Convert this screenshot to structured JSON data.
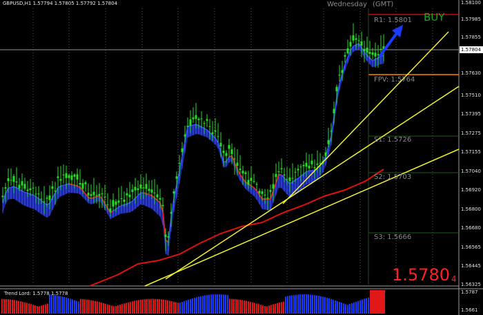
{
  "header": {
    "symbol_info": "GBPUSD,H1  1.57794 1.57805 1.57792 1.57804",
    "day": "Wednesday",
    "timezone": "(GMT)",
    "signal": "BUY"
  },
  "levels": {
    "r1": "R1: 1.5801",
    "fpv": "FPV: 1.5764",
    "s1": "S1: 1.5726",
    "s2": "S2: 1.5703",
    "s3": "S3: 1.5666"
  },
  "current_price": {
    "main": "1.5780",
    "pip_digit": "4",
    "axis_box": "1.57804"
  },
  "price_axis": {
    "ticks": [
      "1.58100",
      "1.57985",
      "1.57855",
      "1.57630",
      "1.57510",
      "1.57395",
      "1.57275",
      "1.57155",
      "1.57040",
      "1.56920",
      "1.56800",
      "1.56680",
      "1.56565",
      "1.56445",
      "1.56325"
    ]
  },
  "indicator": {
    "label": "Trend Lord: 1.5778 1.5778",
    "ticks": [
      "1.5787",
      "1.5661"
    ]
  },
  "colors": {
    "background": "#000000",
    "candles": "#22e022",
    "slow_ma": "#e01010",
    "band": "#1e2fd0",
    "trend_lines": "#f2f230",
    "fpv_line": "#ff8800",
    "r1_line": "#c01010",
    "signal_arrow": "#1b3cff",
    "big_price": "#ff2020"
  },
  "icons": {
    "signal_arrow": "arrow-up-right-icon"
  }
}
